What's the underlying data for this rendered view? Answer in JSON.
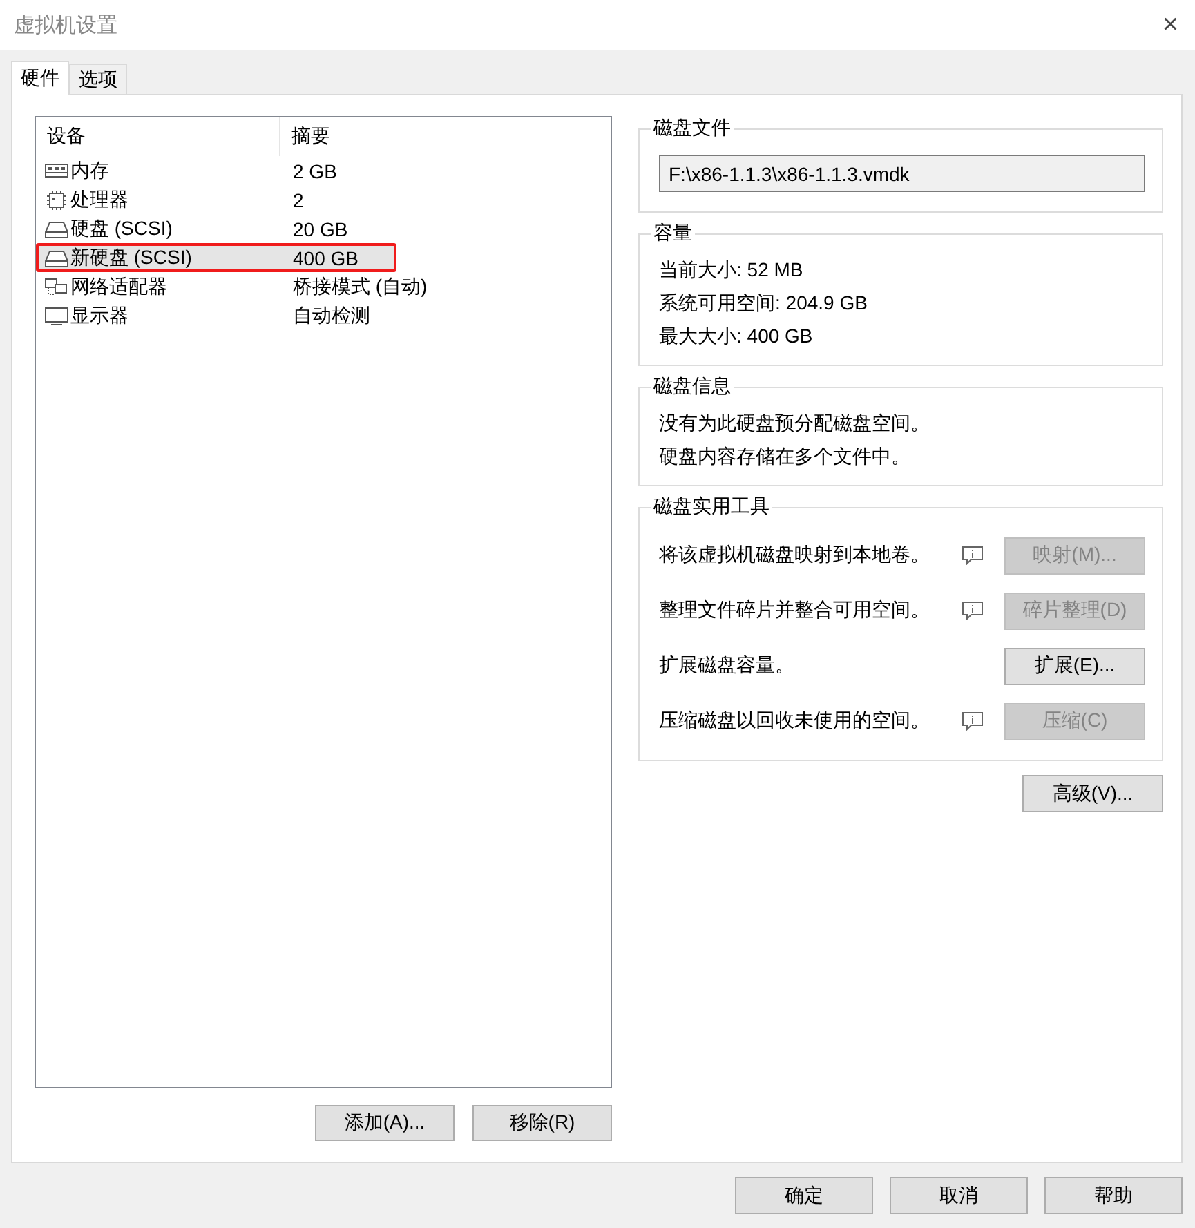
{
  "window": {
    "title": "虚拟机设置",
    "close": "×"
  },
  "tabs": [
    {
      "label": "硬件",
      "selected": true
    },
    {
      "label": "选项",
      "selected": false
    }
  ],
  "devices": {
    "columns": [
      "设备",
      "摘要"
    ],
    "rows": [
      {
        "kind": "memory",
        "name": "内存",
        "summary": "2 GB",
        "selected": false,
        "marked": false
      },
      {
        "kind": "cpu",
        "name": "处理器",
        "summary": "2",
        "selected": false,
        "marked": false
      },
      {
        "kind": "disk",
        "name": "硬盘 (SCSI)",
        "summary": "20 GB",
        "selected": false,
        "marked": false
      },
      {
        "kind": "disk",
        "name": "新硬盘 (SCSI)",
        "summary": "400 GB",
        "selected": true,
        "marked": true
      },
      {
        "kind": "network",
        "name": "网络适配器",
        "summary": "桥接模式 (自动)",
        "selected": false,
        "marked": false
      },
      {
        "kind": "display",
        "name": "显示器",
        "summary": "自动检测",
        "selected": false,
        "marked": false
      }
    ],
    "buttons": [
      {
        "label": "添加(A)...",
        "disabled": false
      },
      {
        "label": "移除(R)",
        "disabled": false
      }
    ]
  },
  "disk_file": {
    "title": "磁盘文件",
    "value": "F:\\x86-1.1.3\\x86-1.1.3.vmdk"
  },
  "capacity": {
    "title": "容量",
    "lines": [
      "当前大小: 52 MB",
      "系统可用空间: 204.9 GB",
      "最大大小: 400 GB"
    ]
  },
  "disk_info": {
    "title": "磁盘信息",
    "lines": [
      "没有为此硬盘预分配磁盘空间。",
      "硬盘内容存储在多个文件中。"
    ]
  },
  "utilities": {
    "title": "磁盘实用工具",
    "items": [
      {
        "text": "将该虚拟机磁盘映射到本地卷。",
        "info": true,
        "button": "映射(M)...",
        "disabled": true
      },
      {
        "text": "整理文件碎片并整合可用空间。",
        "info": true,
        "button": "碎片整理(D)",
        "disabled": true
      },
      {
        "text": "扩展磁盘容量。",
        "info": false,
        "button": "扩展(E)...",
        "disabled": false
      },
      {
        "text": "压缩磁盘以回收未使用的空间。",
        "info": true,
        "button": "压缩(C)",
        "disabled": true
      }
    ]
  },
  "advanced_button": "高级(V)...",
  "footer_buttons": [
    "确定",
    "取消",
    "帮助"
  ]
}
